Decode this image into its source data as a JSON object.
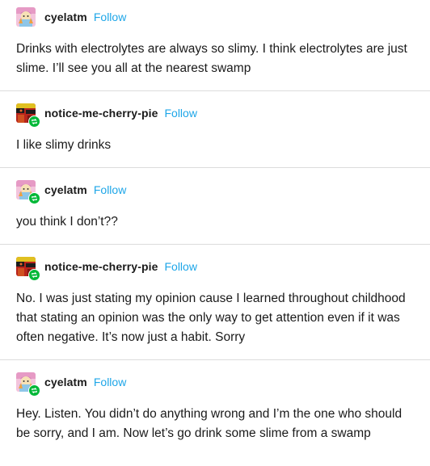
{
  "posts": [
    {
      "username": "cyelatm",
      "follow_label": "Follow",
      "avatar": "cyelatm-avatar",
      "reblog_badge": false,
      "text": "Drinks with electrolytes are always so slimy. I think electrolytes are just slime. I’ll see you all at the nearest swamp"
    },
    {
      "username": "notice-me-cherry-pie",
      "follow_label": "Follow",
      "avatar": "cherry-pie-avatar",
      "reblog_badge": true,
      "text": "I like slimy drinks"
    },
    {
      "username": "cyelatm",
      "follow_label": "Follow",
      "avatar": "cyelatm-avatar",
      "reblog_badge": true,
      "text": "you think I don’t??"
    },
    {
      "username": "notice-me-cherry-pie",
      "follow_label": "Follow",
      "avatar": "cherry-pie-avatar",
      "reblog_badge": true,
      "text": "No. I was just stating my opinion cause I learned throughout childhood that stating an opinion was the only way to get attention even if it was often negative. It’s now just a habit. Sorry"
    },
    {
      "username": "cyelatm",
      "follow_label": "Follow",
      "avatar": "cyelatm-avatar",
      "reblog_badge": true,
      "text": "Hey. Listen. You didn’t do anything wrong and I’m the one who should be sorry, and I am. Now let’s go drink some slime from a swamp"
    }
  ],
  "colors": {
    "follow": "#1ea6e8",
    "reblog_badge": "#00b838",
    "divider": "#dcdcdc"
  }
}
